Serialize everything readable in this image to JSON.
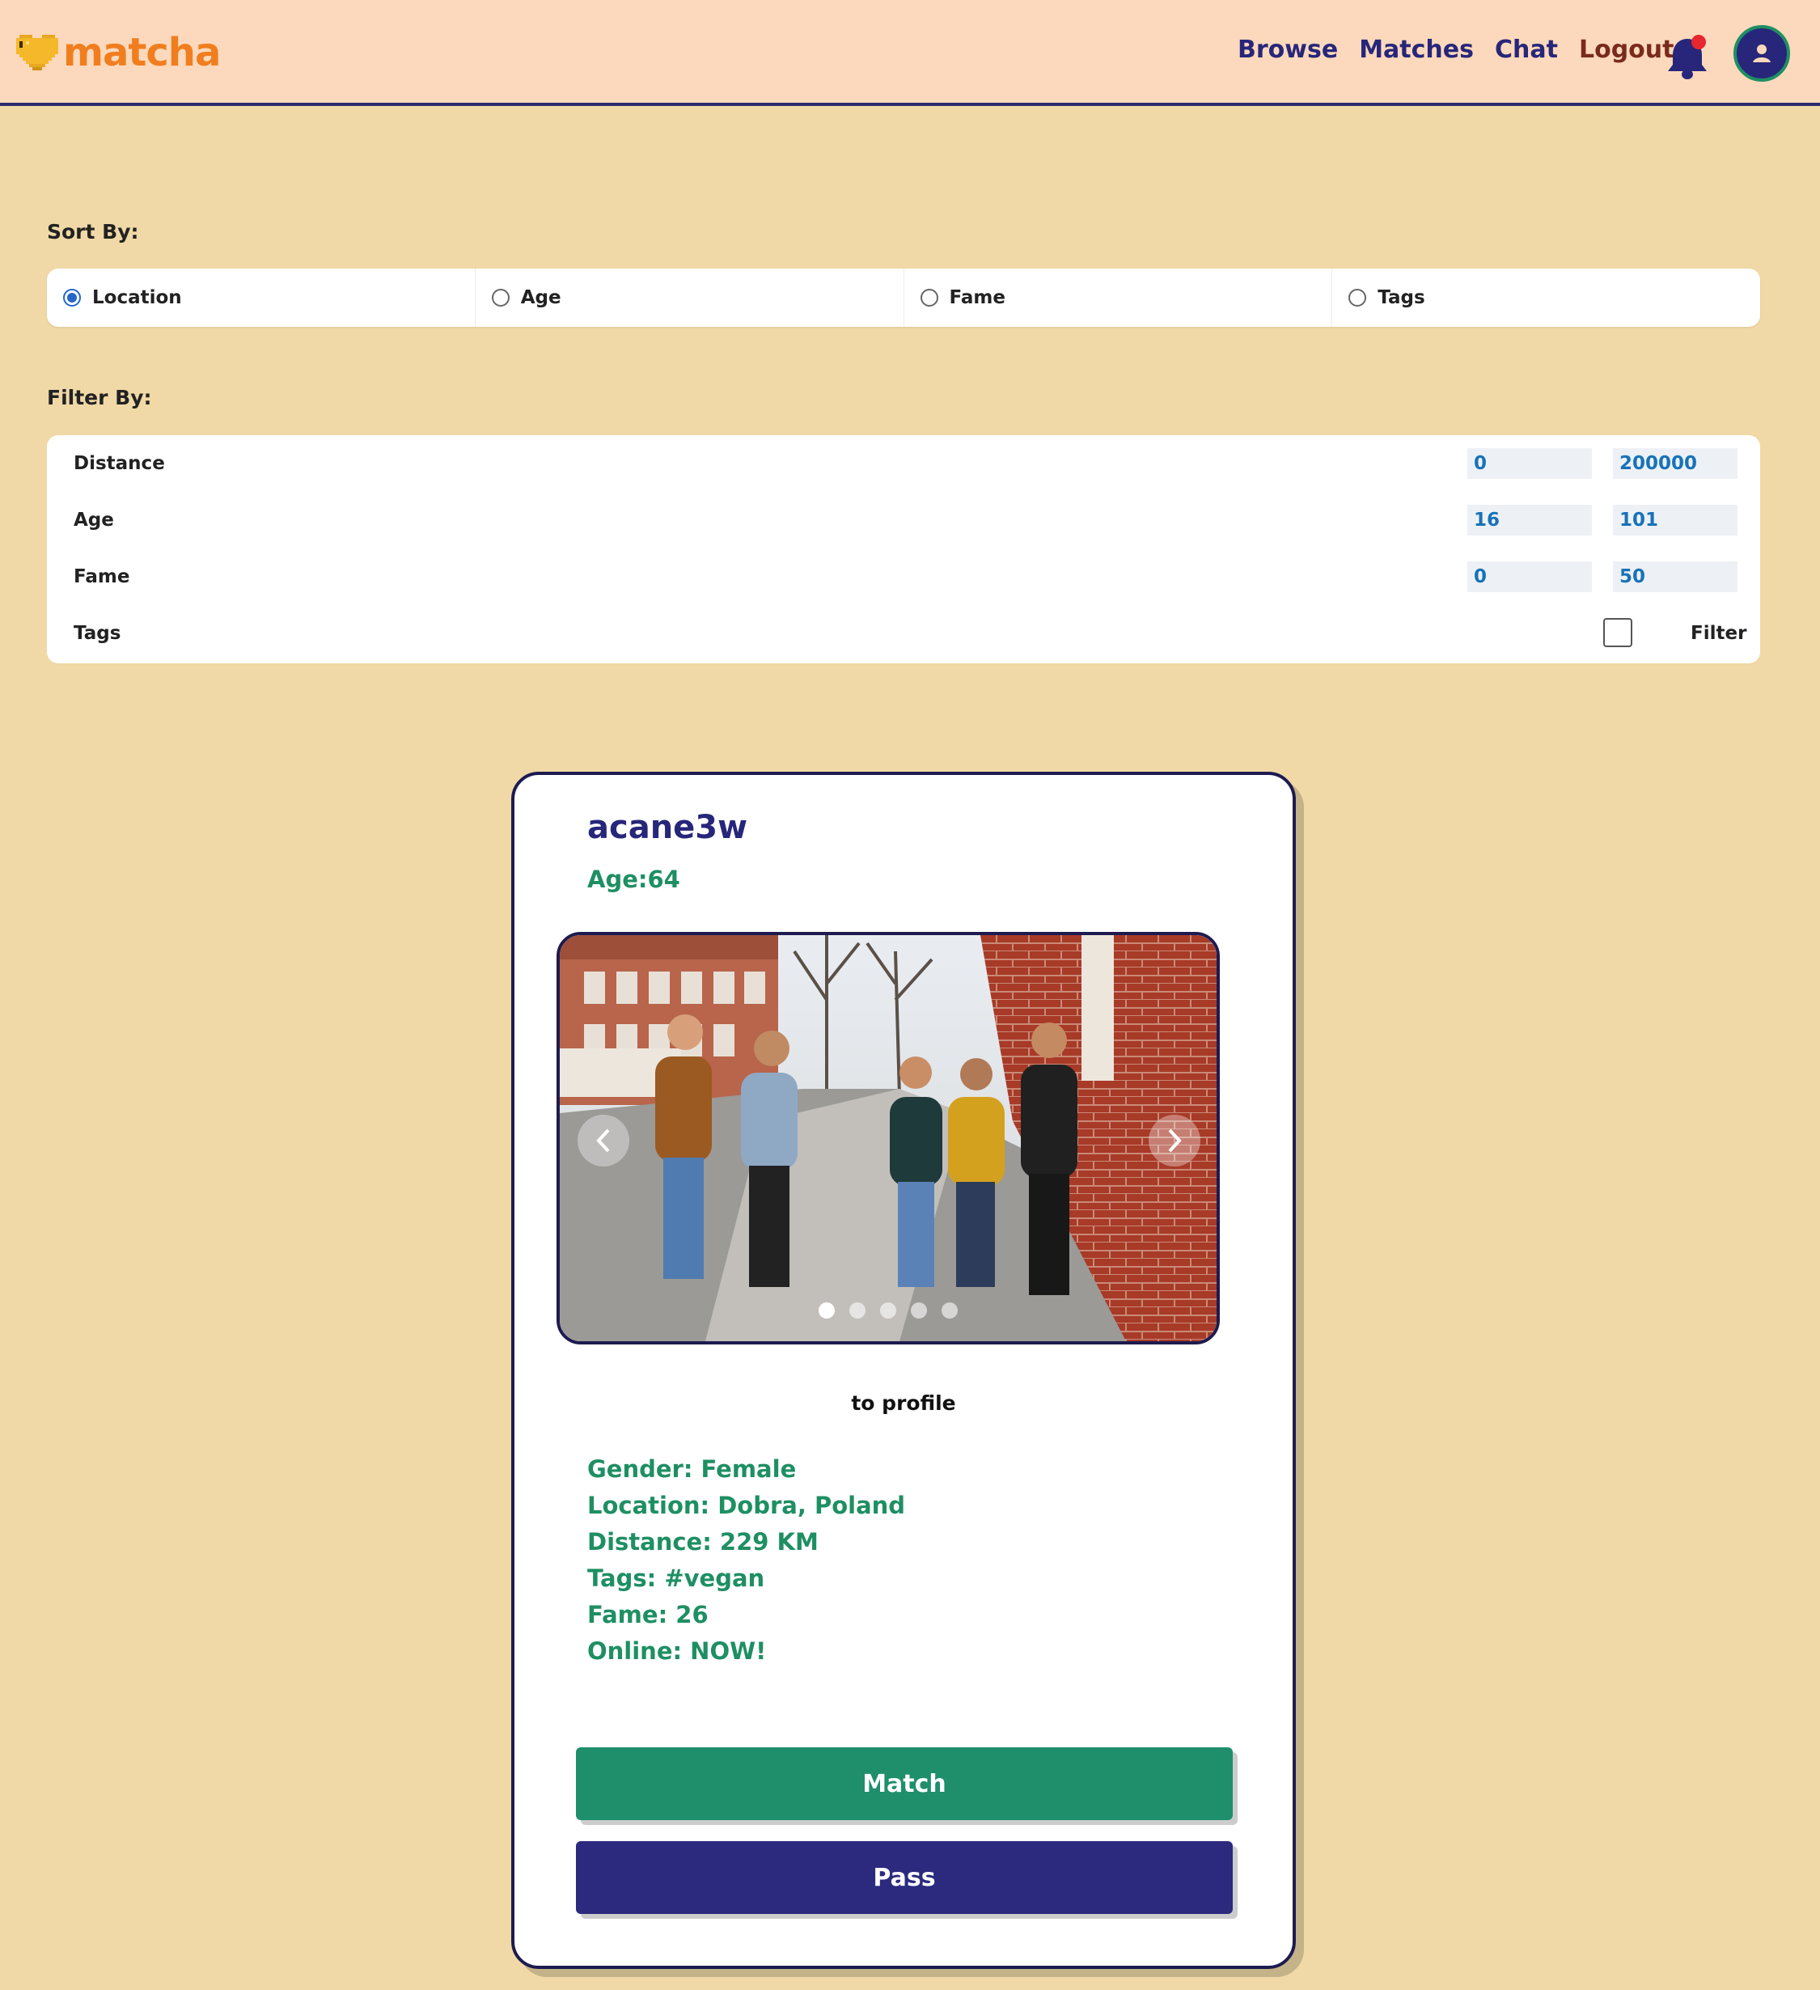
{
  "header": {
    "logo_text": "matcha",
    "nav": [
      "Browse",
      "Matches",
      "Chat",
      "Logout"
    ],
    "icons": {
      "notifications": "bell-icon",
      "profile": "user-avatar-icon"
    },
    "colors": {
      "brand": "#f07e1f",
      "nav": "#27267a",
      "logout": "#7a2a1c",
      "notification_dot": "#e8262f"
    }
  },
  "sort": {
    "label": "Sort By:",
    "options": [
      "Location",
      "Age",
      "Fame",
      "Tags"
    ],
    "selected": "Location"
  },
  "filter": {
    "label": "Filter By:",
    "distance": {
      "label": "Distance",
      "min": "0",
      "max": "200000"
    },
    "age": {
      "label": "Age",
      "min": "16",
      "max": "101"
    },
    "fame": {
      "label": "Fame",
      "min": "0",
      "max": "50"
    },
    "tags": {
      "label": "Tags",
      "checked": false,
      "button_label": "Filter"
    }
  },
  "profile": {
    "username": "acane3w",
    "age_text": "Age:64",
    "photo_count": 5,
    "active_photo": 1,
    "to_profile_label": "to profile",
    "details": [
      "Gender: Female",
      "Location: Dobra, Poland",
      "Distance: 229 KM",
      "Tags: #vegan",
      "Fame: 26",
      "Online: NOW!"
    ],
    "match_label": "Match",
    "pass_label": "Pass",
    "colors": {
      "accent": "#1e8f63",
      "primary": "#27267a"
    }
  }
}
